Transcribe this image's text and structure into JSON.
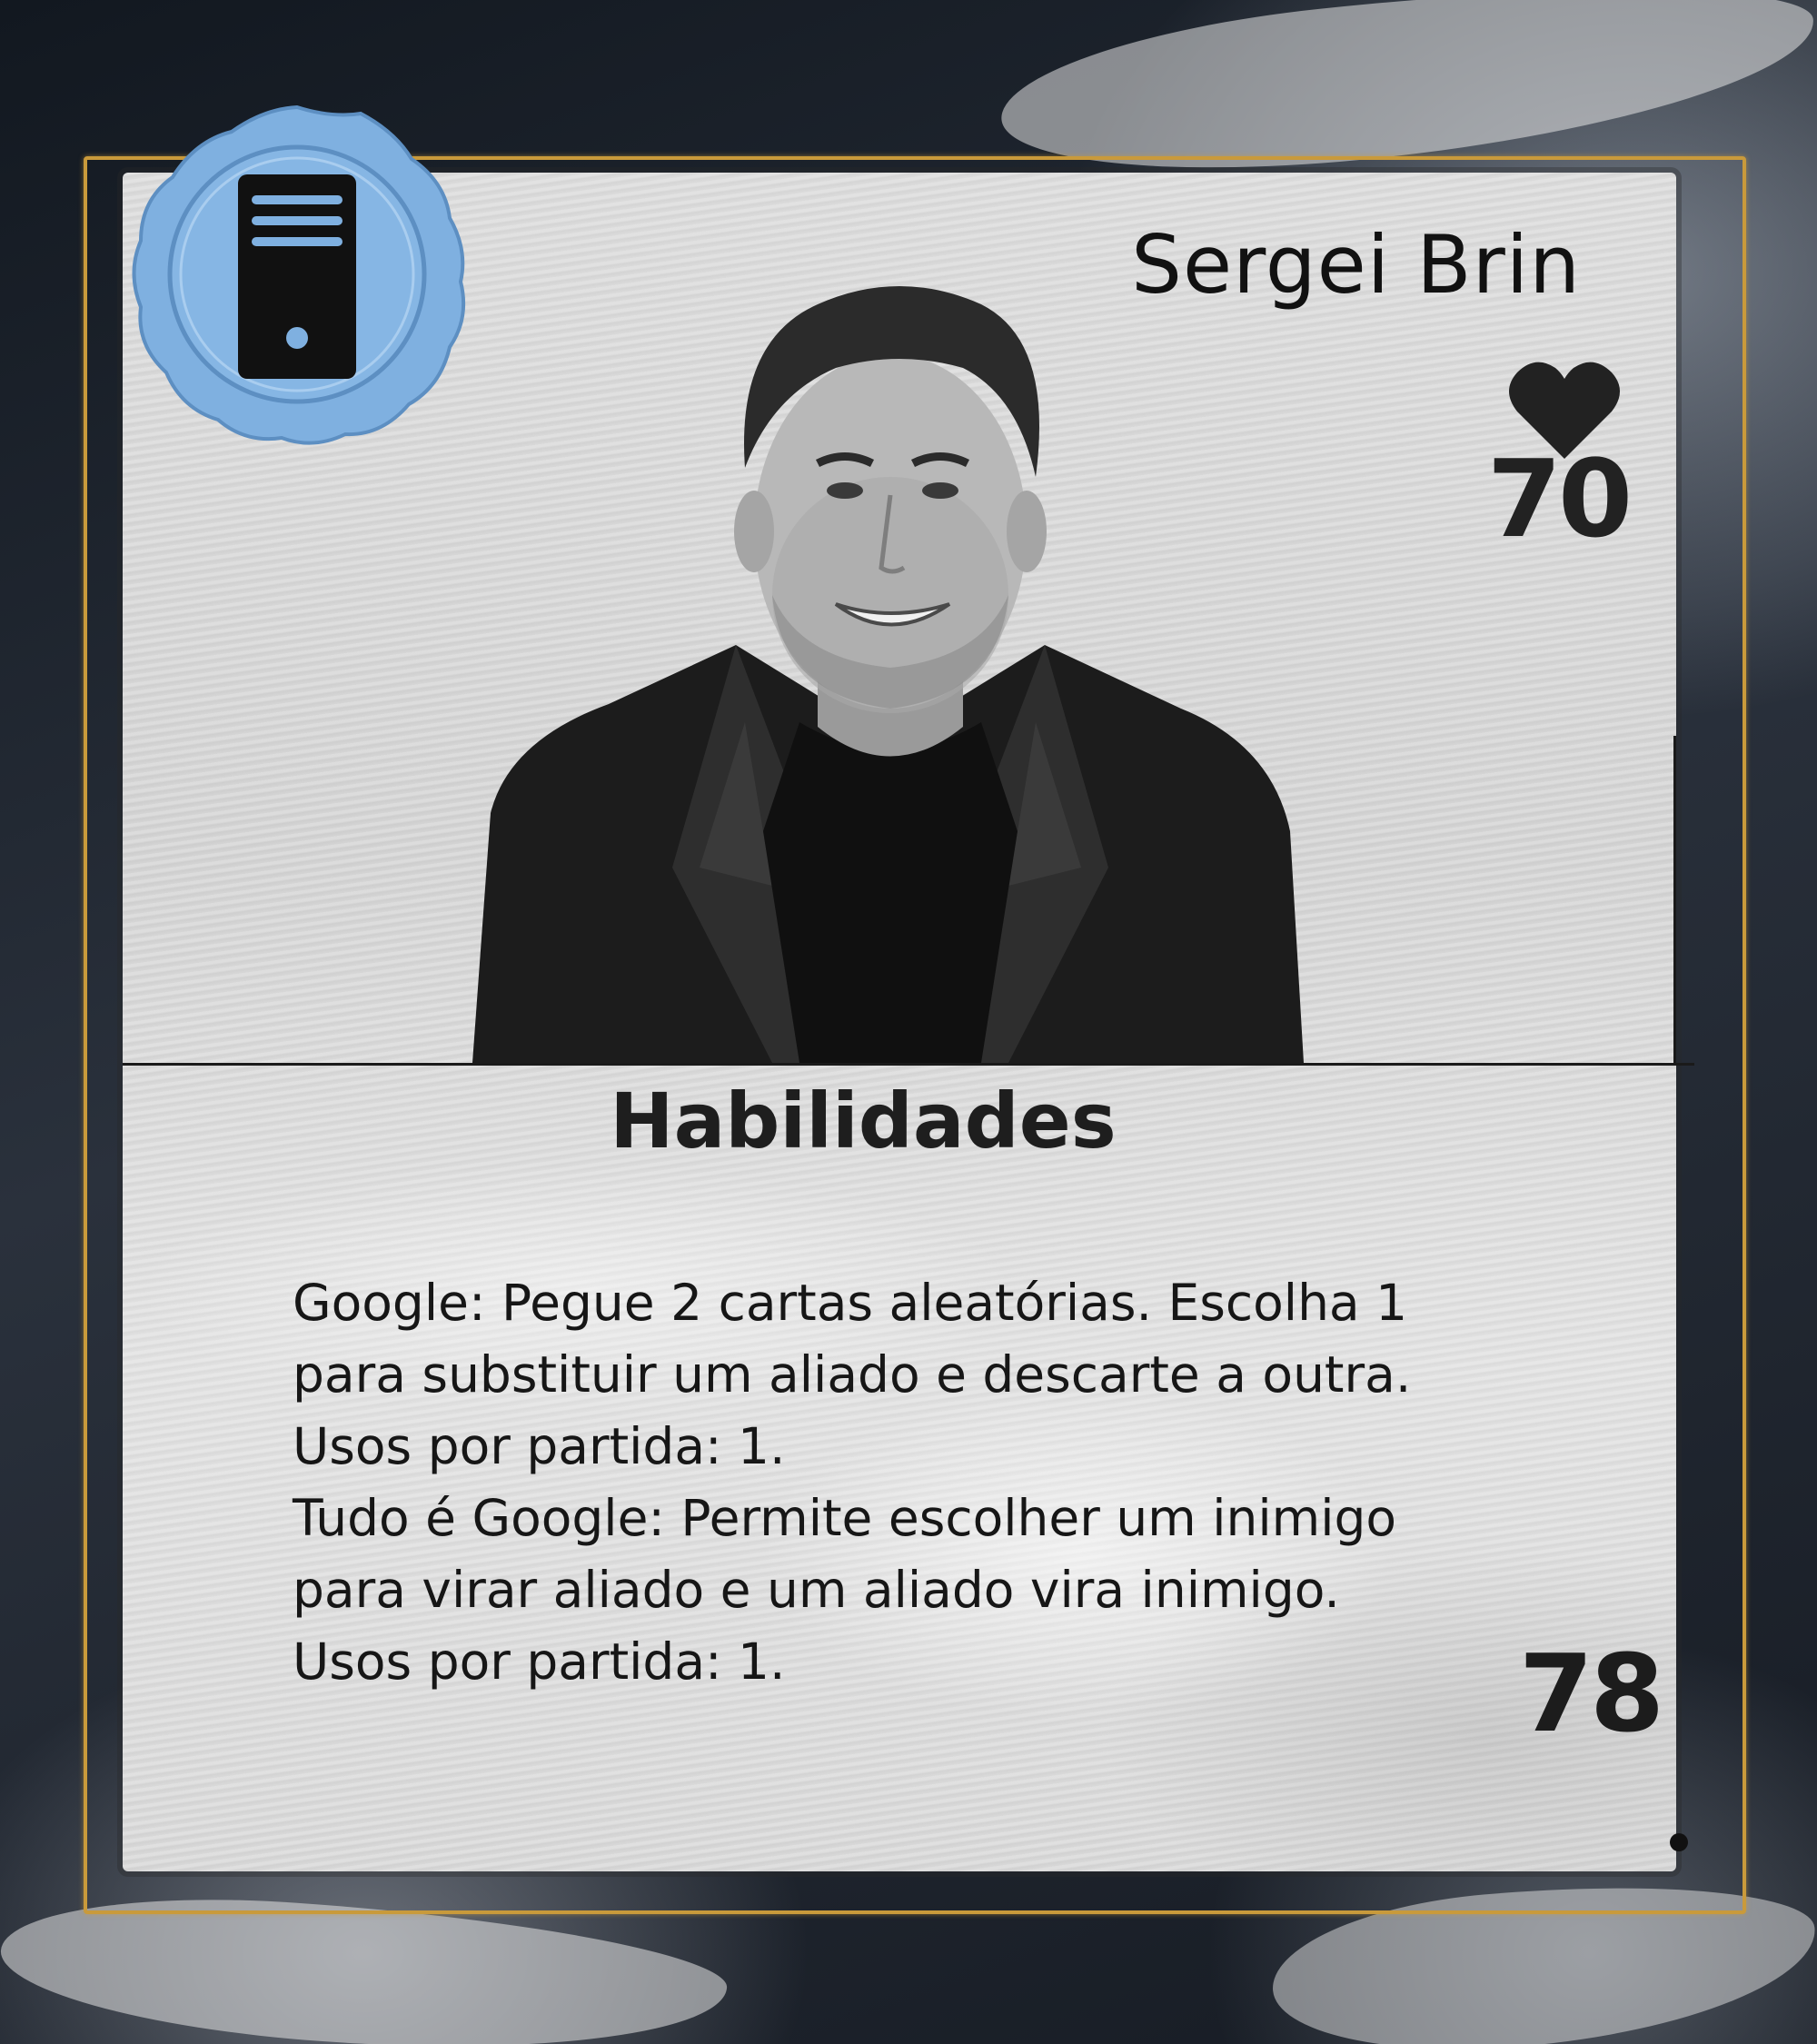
{
  "card": {
    "name": "Sergei Brin",
    "life_value": "70",
    "abilities_heading": "Habilidades",
    "abilities_lines": [
      "Google: Pegue 2 cartas aleatórias. Escolha 1",
      "para substituir um aliado e descarte a outra.",
      "Usos por partida: 1.",
      "Tudo é Google: Permite escolher um inimigo",
      "para virar aliado e um aliado vira inimigo.",
      "Usos por partida: 1."
    ],
    "power_value": "78",
    "seal_icon": "computer-tower-icon",
    "life_icon": "heart-icon"
  },
  "colors": {
    "seal_blue": "#7fb0e0",
    "frame_gold": "#c99a3b",
    "text_dark": "#161616",
    "panel_gray": "#dcdcdc"
  }
}
